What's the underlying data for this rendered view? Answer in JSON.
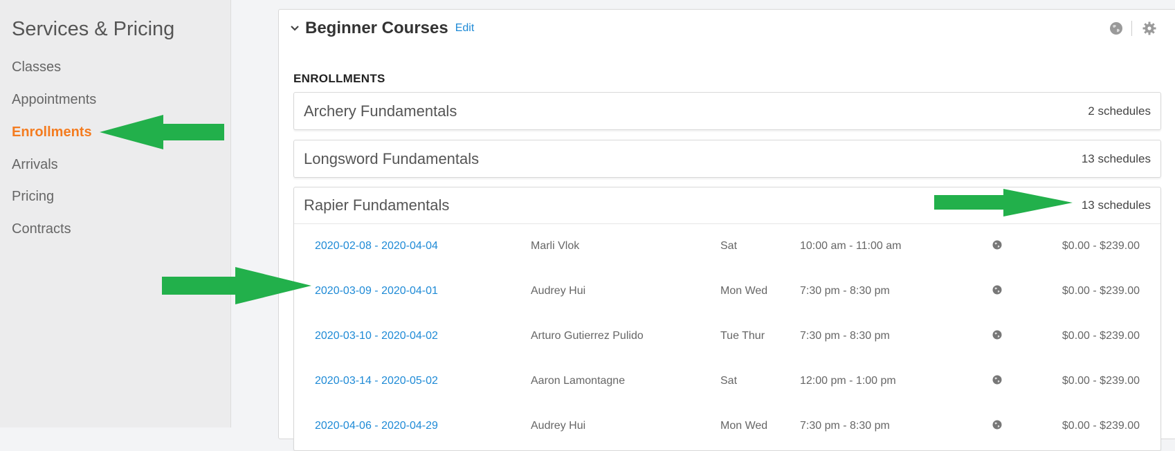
{
  "sidebar": {
    "title": "Services & Pricing",
    "items": [
      {
        "label": "Classes",
        "active": false
      },
      {
        "label": "Appointments",
        "active": false
      },
      {
        "label": "Enrollments",
        "active": true
      },
      {
        "label": "Arrivals",
        "active": false
      },
      {
        "label": "Pricing",
        "active": false
      },
      {
        "label": "Contracts",
        "active": false
      }
    ]
  },
  "course": {
    "title": "Beginner Courses",
    "edit_label": "Edit",
    "section_label": "ENROLLMENTS",
    "groups": [
      {
        "name": "Archery Fundamentals",
        "count": "2 schedules"
      },
      {
        "name": "Longsword Fundamentals",
        "count": "13 schedules"
      },
      {
        "name": "Rapier Fundamentals",
        "count": "13 schedules"
      }
    ],
    "schedules": [
      {
        "dates": "2020-02-08 - 2020-04-04",
        "instructor": "Marli Vlok",
        "days": "Sat",
        "time": "10:00 am - 11:00 am",
        "price": "$0.00 - $239.00"
      },
      {
        "dates": "2020-03-09 - 2020-04-01",
        "instructor": "Audrey Hui",
        "days": "Mon Wed",
        "time": "7:30 pm - 8:30 pm",
        "price": "$0.00 - $239.00"
      },
      {
        "dates": "2020-03-10 - 2020-04-02",
        "instructor": "Arturo Gutierrez Pulido",
        "days": "Tue Thur",
        "time": "7:30 pm - 8:30 pm",
        "price": "$0.00 - $239.00"
      },
      {
        "dates": "2020-03-14 - 2020-05-02",
        "instructor": "Aaron Lamontagne",
        "days": "Sat",
        "time": "12:00 pm - 1:00 pm",
        "price": "$0.00 - $239.00"
      },
      {
        "dates": "2020-04-06 - 2020-04-29",
        "instructor": "Audrey Hui",
        "days": "Mon Wed",
        "time": "7:30 pm - 8:30 pm",
        "price": "$0.00 - $239.00"
      }
    ]
  },
  "colors": {
    "accent_active": "#f47c20",
    "link": "#1e8ad6",
    "annotation_arrow": "#22b04b"
  },
  "icons": [
    "chevron-down-icon",
    "globe-icon",
    "gear-icon"
  ]
}
